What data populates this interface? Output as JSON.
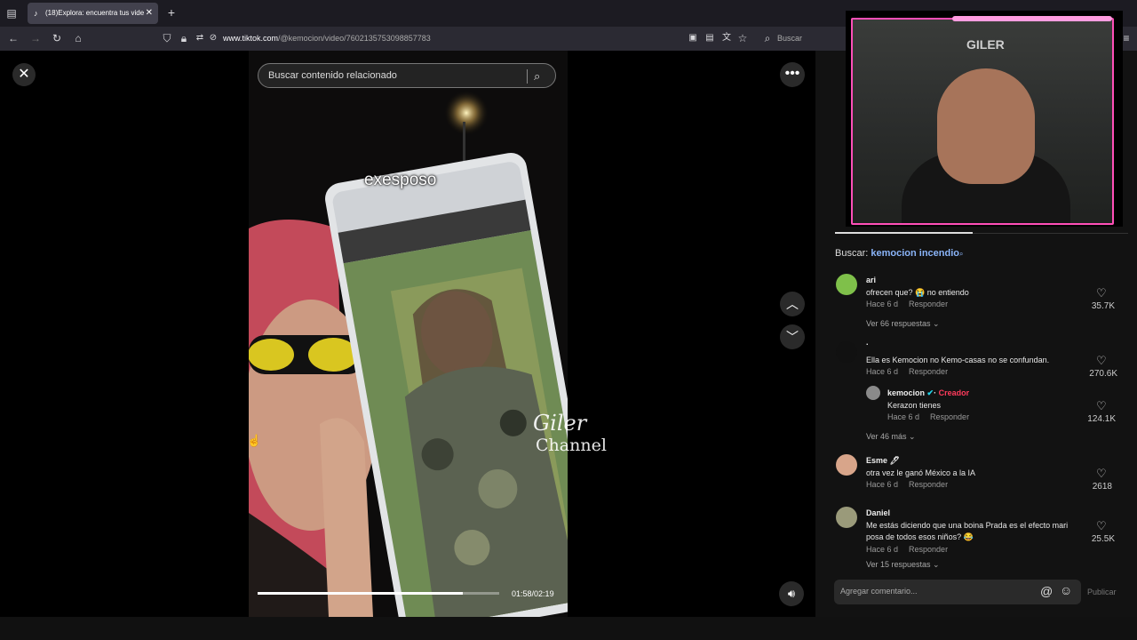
{
  "browser": {
    "tab_title": "(18)Explora: encuentra tus vide",
    "tab_close": "✕",
    "new_tab": "+",
    "url_domain": "www.tiktok.com",
    "url_path": "/@kemocion/video/7602135753098857783",
    "search_placeholder": "Buscar"
  },
  "viewer": {
    "search_placeholder": "Buscar contenido relacionado",
    "caption": "exesposo",
    "time_current": "01:58",
    "time_total": "02:19",
    "progress": 0.85,
    "watermark_line1": "Giler",
    "watermark_line2": "Channel"
  },
  "panel": {
    "buscar_label": "Buscar:",
    "buscar_keyword": "kemocion incendio",
    "comments": [
      {
        "name": "ari",
        "text": "ofrecen que? 😭 no entiendo",
        "time": "Hace 6 d",
        "reply": "Responder",
        "likes": "35.7K",
        "more": "Ver 66 respuestas ⌄"
      },
      {
        "name": ".",
        "text": "Ella es Kemocion no Kemo-casas no se confundan.",
        "time": "Hace 6 d",
        "reply": "Responder",
        "likes": "270.6K"
      },
      {
        "name": "kemocion",
        "creator": "Creador",
        "text": "Kerazon tienes",
        "time": "Hace 6 d",
        "reply": "Responder",
        "likes": "124.1K",
        "more": "Ver 46 más ⌄"
      },
      {
        "name": "Esme 🖊",
        "text": "otra vez le ganó México a la IA",
        "time": "Hace 6 d",
        "reply": "Responder",
        "likes": "2618"
      },
      {
        "name": "Daniel",
        "text_line1": "Me estás diciendo que una boina Prada es el efecto mari",
        "text_line2": "posa de todos esos niños? 😂",
        "time": "Hace 6 d",
        "reply": "Responder",
        "likes": "25.5K",
        "more": "Ver 15 respuestas ⌄"
      }
    ],
    "comment_placeholder": "Agregar comentario...",
    "publish_label": "Publicar"
  },
  "webcam": {
    "sign_text": "GILER"
  }
}
